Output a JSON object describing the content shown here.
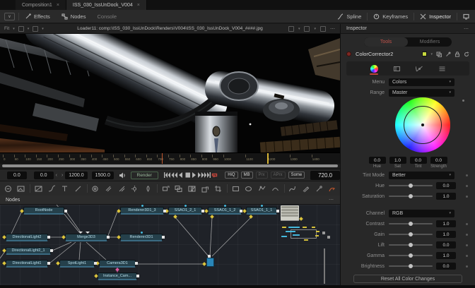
{
  "tabs": {
    "close_glyph": "×",
    "items": [
      "Composition1",
      "ISS_030_IssUnDock_V004"
    ]
  },
  "toolbar": {
    "effects": "Effects",
    "nodes": "Nodes",
    "console": "Console",
    "spline": "Spline",
    "keyframes": "Keyframes",
    "inspector": "Inspector"
  },
  "viewer": {
    "fit_label": "Fit",
    "loader_title": "Loader11: comp:\\ISS_030_IssUnDock\\Renders\\V004\\ISS_030_IssUnDock_V004_####.jpg",
    "more_glyph": "⋯"
  },
  "timeline": {
    "ticks": [
      0,
      50,
      100,
      150,
      200,
      250,
      300,
      350,
      400,
      450,
      500,
      550,
      600,
      650,
      700,
      750,
      800,
      850,
      900,
      950,
      1000,
      1100,
      1200,
      1300,
      1400
    ],
    "playhead_frame": 720,
    "marker_frame": 1200
  },
  "transport": {
    "val1": "0.0",
    "val2": "0.0",
    "prev_glyph": "‹",
    "next_glyph": "›",
    "range_start": "1200.0",
    "range_end": "1500.0",
    "render_label": "Render",
    "hiq": "HiQ",
    "mb": "MB",
    "prx": "Prx",
    "aprx": "APrx",
    "some": "Some",
    "current_frame": "720.0"
  },
  "nodes_panel": {
    "title": "Nodes",
    "more_glyph": "⋯",
    "graph": [
      "RootNode",
      "Renderer3D1_3",
      "SSAO1_2_1",
      "SSAO1_1_2",
      "SSAO1_1_1",
      "DirectionalLight2",
      "Merge3D3",
      "Renderer3D1",
      "DirectionalLight2_1",
      "DirectionalLight1",
      "SpotLight1",
      "Camera3D1",
      "Instance_Cam..."
    ]
  },
  "inspector": {
    "title": "Inspector",
    "more_glyph": "⋯",
    "tab_tools": "Tools",
    "tab_modifiers": "Modifiers",
    "tool_name": "ColorCorrector2",
    "menu_label": "Menu",
    "menu_value": "Colors",
    "range_label": "Range",
    "range_value": "Master",
    "wheel_values": [
      {
        "v": "0.0",
        "l": "Hue"
      },
      {
        "v": "1.0",
        "l": "Sat"
      },
      {
        "v": "0.0",
        "l": "Tint"
      },
      {
        "v": "0.0",
        "l": "Strength"
      }
    ],
    "tint_mode_label": "Tint Mode",
    "tint_mode_value": "Better",
    "hue_label": "Hue",
    "hue_value": "0.0",
    "saturation_label": "Saturation",
    "saturation_value": "1.0",
    "channel_label": "Channel",
    "channel_value": "RGB",
    "contrast_label": "Contrast",
    "contrast_value": "1.0",
    "gain_label": "Gain",
    "gain_value": "1.0",
    "lift_label": "Lift",
    "lift_value": "0.0",
    "gamma_label": "Gamma",
    "gamma_value": "1.0",
    "brightness_label": "Brightness",
    "brightness_value": "0.0",
    "reset_label": "Reset All Color Changes"
  },
  "colors": {
    "accent_red": "#c0443a",
    "playhead_orange": "#c4582e",
    "marker_yellow": "#d8b435",
    "node_yellow": "#dcc43c",
    "node_cyan": "#45b8dc",
    "selection_blue": "#2a86b8",
    "render_green": "#9cbb9d",
    "swatch_green": "#c6d93f"
  }
}
